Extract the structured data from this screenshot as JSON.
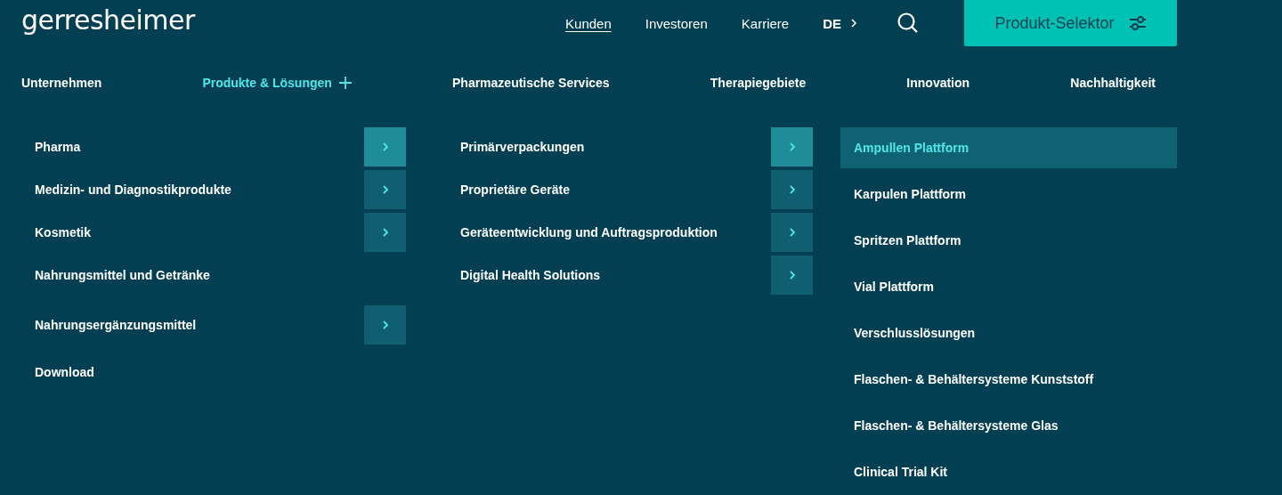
{
  "logo": "gerresheimer",
  "top_nav": [
    {
      "label": "Kunden",
      "selected": true
    },
    {
      "label": "Investoren",
      "selected": false
    },
    {
      "label": "Karriere",
      "selected": false
    }
  ],
  "language": "DE",
  "product_selector": "Produkt-Selektor",
  "main_nav": [
    {
      "label": "Unternehmen",
      "selected": false
    },
    {
      "label": "Produkte & Lösungen",
      "selected": true
    },
    {
      "label": "Pharmazeutische Services",
      "selected": false
    },
    {
      "label": "Therapiegebiete",
      "selected": false
    },
    {
      "label": "Innovation",
      "selected": false
    },
    {
      "label": "Nachhaltigkeit",
      "selected": false
    }
  ],
  "menu_columns": [
    {
      "items": [
        {
          "label": "Pharma",
          "has_submenu": true,
          "selected": true
        },
        {
          "label": "Medizin- und Diagnostikprodukte",
          "has_submenu": true,
          "selected": false
        },
        {
          "label": "Kosmetik",
          "has_submenu": true,
          "selected": false
        },
        {
          "label": "Nahrungsmittel und Getränke",
          "has_submenu": false,
          "selected": false
        },
        {
          "label": "Nahrungsergänzungsmittel",
          "has_submenu": true,
          "selected": false
        },
        {
          "label": "Download",
          "has_submenu": false,
          "selected": false
        }
      ]
    },
    {
      "items": [
        {
          "label": "Primärverpackungen",
          "has_submenu": true,
          "selected": true
        },
        {
          "label": "Proprietäre Geräte",
          "has_submenu": true,
          "selected": false
        },
        {
          "label": "Geräteentwicklung und Auftragsproduktion",
          "has_submenu": true,
          "selected": false
        },
        {
          "label": "Digital Health Solutions",
          "has_submenu": true,
          "selected": false
        }
      ]
    }
  ],
  "submenu_items": [
    {
      "label": "Ampullen Plattform",
      "selected": true
    },
    {
      "label": "Karpulen Plattform",
      "selected": false
    },
    {
      "label": "Spritzen Plattform",
      "selected": false
    },
    {
      "label": "Vial Plattform",
      "selected": false
    },
    {
      "label": "Verschlusslösungen",
      "selected": false
    },
    {
      "label": "Flaschen- & Behältersysteme Kunststoff",
      "selected": false
    },
    {
      "label": "Flaschen- & Behältersysteme Glas",
      "selected": false
    },
    {
      "label": "Clinical Trial Kit",
      "selected": false
    }
  ]
}
